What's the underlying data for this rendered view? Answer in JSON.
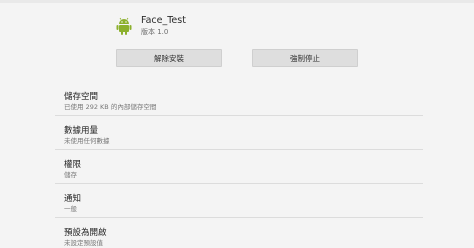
{
  "app": {
    "name": "Face_Test",
    "version": "版本 1.0",
    "icon": "android-icon",
    "icon_color": "#8cb02d"
  },
  "buttons": {
    "uninstall": "解除安裝",
    "force_stop": "強制停止"
  },
  "settings": [
    {
      "title": "儲存空間",
      "summary": "已使用 292 KB 的內部儲存空間"
    },
    {
      "title": "數據用量",
      "summary": "未使用任何數據"
    },
    {
      "title": "權限",
      "summary": "儲存"
    },
    {
      "title": "通知",
      "summary": "一般"
    },
    {
      "title": "預設為開啟",
      "summary": "未設定預設值"
    }
  ]
}
